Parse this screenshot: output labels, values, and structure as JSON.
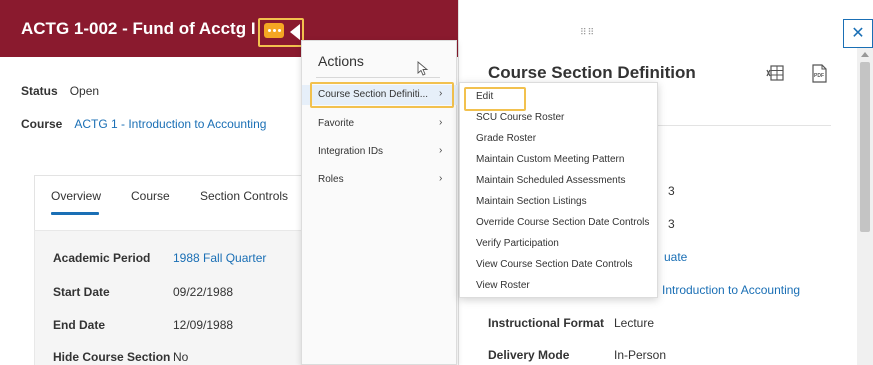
{
  "header": {
    "title": "ACTG 1-002 - Fund of Acctg I"
  },
  "summary": {
    "status_label": "Status",
    "status_value": "Open",
    "course_label": "Course",
    "course_value": "ACTG 1 - Introduction to Accounting"
  },
  "tabs": [
    {
      "label": "Overview"
    },
    {
      "label": "Course"
    },
    {
      "label": "Section Controls"
    }
  ],
  "details": [
    {
      "label": "Academic Period",
      "value": "1988 Fall Quarter"
    },
    {
      "label": "Start Date",
      "value": "09/22/1988"
    },
    {
      "label": "End Date",
      "value": "12/09/1988"
    },
    {
      "label": "Hide Course Section",
      "value": "No"
    }
  ],
  "actions": {
    "title": "Actions",
    "items": [
      {
        "label": "Course Section Definiti..."
      },
      {
        "label": "Favorite"
      },
      {
        "label": "Integration IDs"
      },
      {
        "label": "Roles"
      }
    ]
  },
  "submenu": {
    "items": [
      {
        "label": "Edit"
      },
      {
        "label": "SCU Course Roster"
      },
      {
        "label": "Grade Roster"
      },
      {
        "label": "Maintain Custom Meeting Pattern"
      },
      {
        "label": "Maintain Scheduled Assessments"
      },
      {
        "label": "Maintain Section Listings"
      },
      {
        "label": "Override Course Section Date Controls"
      },
      {
        "label": "Verify Participation"
      },
      {
        "label": "View Course Section Date Controls"
      },
      {
        "label": "View Roster"
      }
    ]
  },
  "definition": {
    "title": "Course Section Definition",
    "partial": {
      "frag1": "3",
      "frag2": "3",
      "frag3": "uate",
      "frag4": "Introduction to Accounting"
    },
    "rows": [
      {
        "label": "Instructional Format",
        "value": "Lecture"
      },
      {
        "label": "Delivery Mode",
        "value": "In-Person"
      }
    ]
  },
  "glyphs": {
    "chevron": "›",
    "close": "✕",
    "drag": "⠿⠿"
  },
  "colors": {
    "header_bg": "#8a1a2e",
    "highlight_outline": "#f2c14e",
    "link": "#1a6fb5",
    "dots_button": "#f5a623"
  }
}
